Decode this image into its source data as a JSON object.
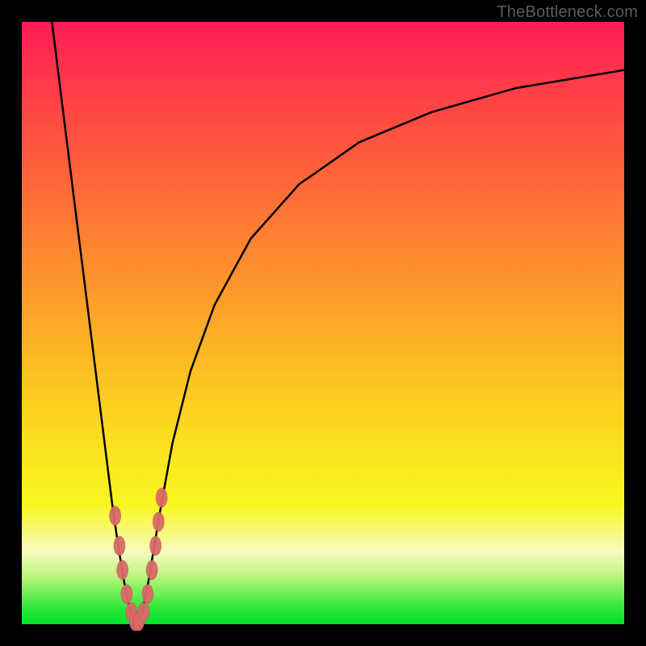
{
  "watermark": "TheBottleneck.com",
  "colors": {
    "curve_stroke": "#000000",
    "marker_fill": "#D96A68",
    "marker_stroke": "#B25452"
  },
  "chart_data": {
    "type": "line",
    "title": "",
    "xlabel": "",
    "ylabel": "",
    "xlim": [
      0,
      100
    ],
    "ylim": [
      0,
      100
    ],
    "note": "Y=100 at top of plot (red), Y=0 at bottom (green). Curve is a V-shaped bottleneck curve with minimum near x≈19.",
    "series": [
      {
        "name": "bottleneck-curve",
        "x": [
          5,
          7,
          9,
          11,
          13,
          15,
          16,
          17,
          18,
          19,
          20,
          21,
          22,
          23,
          25,
          28,
          32,
          38,
          46,
          56,
          68,
          82,
          100
        ],
        "y": [
          100,
          84,
          68,
          52,
          36,
          20,
          13,
          7,
          2,
          0,
          2,
          7,
          13,
          19,
          30,
          42,
          53,
          64,
          73,
          80,
          85,
          89,
          92
        ]
      }
    ],
    "markers": {
      "name": "data-points",
      "x": [
        15.5,
        16.2,
        16.7,
        17.4,
        18.2,
        18.8,
        19.4,
        20.2,
        20.9,
        21.6,
        22.2,
        22.7,
        23.2
      ],
      "y": [
        18,
        13,
        9,
        5,
        2,
        0.5,
        0.5,
        2,
        5,
        9,
        13,
        17,
        21
      ]
    }
  }
}
